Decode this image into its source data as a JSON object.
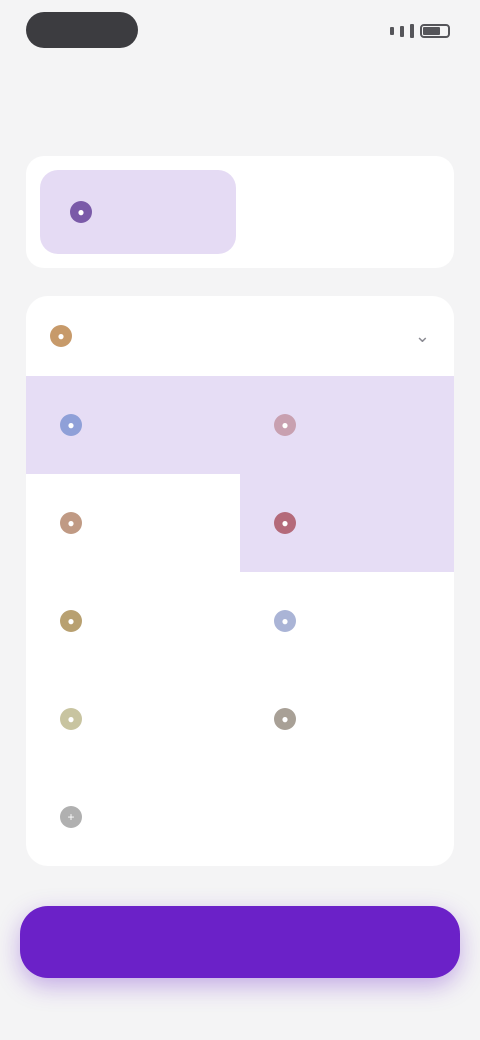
{
  "header": {
    "label": ""
  },
  "segments": [
    {
      "label": "",
      "icon": "person-icon",
      "active": true,
      "icon_color": "#7a5aa8"
    },
    {
      "label": "",
      "icon": "",
      "active": false,
      "icon_color": "#cccccc"
    }
  ],
  "list": {
    "header_label": "",
    "header_icon_color": "#c79a6a",
    "items": [
      {
        "label": "",
        "icon": "clock-icon",
        "icon_color": "#8fa0d8",
        "selected": true
      },
      {
        "label": "",
        "icon": "tag-icon",
        "icon_color": "#c8a0b0",
        "selected": true
      },
      {
        "label": "",
        "icon": "bag-icon",
        "icon_color": "#c09a84",
        "selected": false
      },
      {
        "label": "",
        "icon": "heart-icon",
        "icon_color": "#b46a7a",
        "selected": true
      },
      {
        "label": "",
        "icon": "gift-icon",
        "icon_color": "#b8a070",
        "selected": false
      },
      {
        "label": "",
        "icon": "home-icon",
        "icon_color": "#aab4d6",
        "selected": false
      },
      {
        "label": "",
        "icon": "leaf-icon",
        "icon_color": "#c8c4a0",
        "selected": false
      },
      {
        "label": "",
        "icon": "wallet-icon",
        "icon_color": "#a8a096",
        "selected": false
      },
      {
        "label": "",
        "icon": "plus-icon",
        "icon_color": "#b0b0b0",
        "selected": false
      }
    ]
  },
  "primary_button": {
    "label": ""
  },
  "colors": {
    "accent": "#6b21c8",
    "selected_bg": "#e6ddf5"
  }
}
